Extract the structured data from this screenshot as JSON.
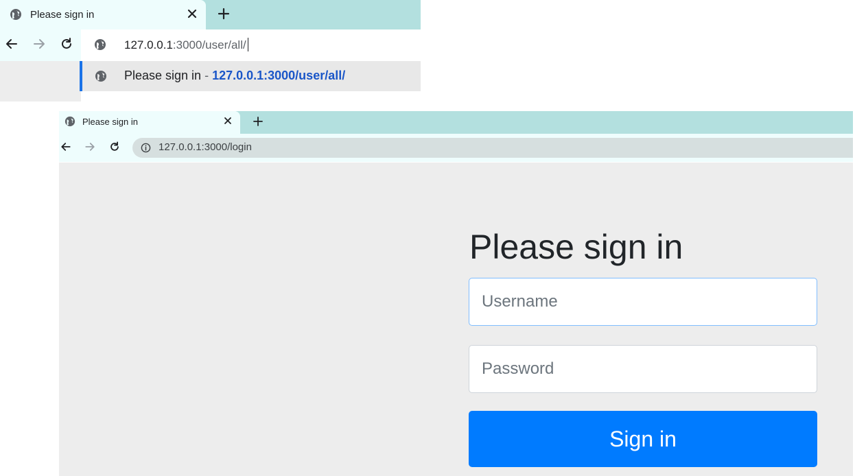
{
  "top_window": {
    "tab": {
      "title": "Please sign in",
      "icon": "globe-icon",
      "close_icon": "close-icon"
    },
    "new_tab_icon": "plus-icon",
    "nav": {
      "back_icon": "back-arrow-icon",
      "forward_icon": "forward-arrow-icon",
      "reload_icon": "reload-icon"
    },
    "omnibox": {
      "value_host": "127.0.0.1",
      "value_rest": ":3000/user/all/"
    },
    "suggestion": {
      "title": "Please sign in",
      "separator": " - ",
      "url": "127.0.0.1:3000/user/all/"
    }
  },
  "bottom_window": {
    "tab": {
      "title": "Please sign in",
      "icon": "globe-icon",
      "close_icon": "close-icon"
    },
    "new_tab_icon": "plus-icon",
    "nav": {
      "back_icon": "back-arrow-icon",
      "forward_icon": "forward-arrow-icon",
      "reload_icon": "reload-icon"
    },
    "address": {
      "info_icon": "info-icon",
      "url": "127.0.0.1:3000/login"
    }
  },
  "login_form": {
    "heading": "Please sign in",
    "username_placeholder": "Username",
    "username_value": "",
    "password_placeholder": "Password",
    "password_value": "",
    "submit_label": "Sign in"
  },
  "colors": {
    "tab_strip": "#b3e0df",
    "active_tab": "#eefdfd",
    "page_background": "#ededed",
    "primary_button": "#007bff",
    "focus_border": "#80bdff",
    "suggestion_url": "#1a56c8"
  }
}
